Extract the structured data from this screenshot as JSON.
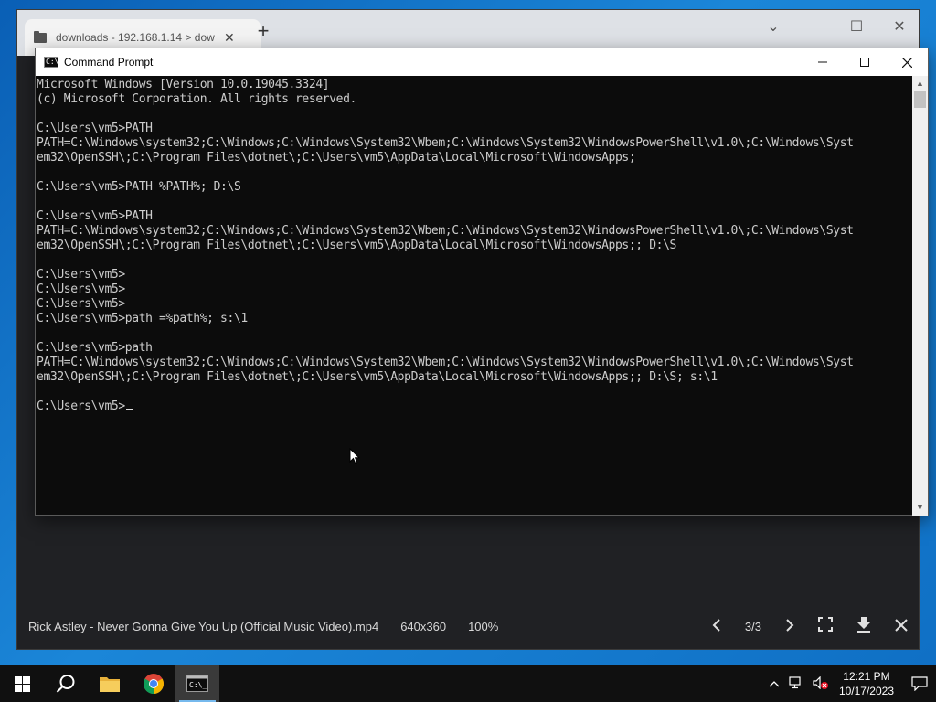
{
  "browser": {
    "tab_title": "downloads - 192.168.1.14 > dow",
    "tab_close": "✕",
    "new_tab": "+",
    "chevron": "⌄",
    "maximize": "☐",
    "close": "✕",
    "viewer": {
      "filename": "Rick Astley - Never Gonna Give You Up (Official Music Video).mp4",
      "dimensions": "640x360",
      "zoom": "100%",
      "pager": "3/3"
    }
  },
  "cmd": {
    "title": "Command Prompt",
    "icon_text": "C:\\",
    "lines": [
      "Microsoft Windows [Version 10.0.19045.3324]",
      "(c) Microsoft Corporation. All rights reserved.",
      "",
      "C:\\Users\\vm5>PATH",
      "PATH=C:\\Windows\\system32;C:\\Windows;C:\\Windows\\System32\\Wbem;C:\\Windows\\System32\\WindowsPowerShell\\v1.0\\;C:\\Windows\\Syst",
      "em32\\OpenSSH\\;C:\\Program Files\\dotnet\\;C:\\Users\\vm5\\AppData\\Local\\Microsoft\\WindowsApps;",
      "",
      "C:\\Users\\vm5>PATH %PATH%; D:\\S",
      "",
      "C:\\Users\\vm5>PATH",
      "PATH=C:\\Windows\\system32;C:\\Windows;C:\\Windows\\System32\\Wbem;C:\\Windows\\System32\\WindowsPowerShell\\v1.0\\;C:\\Windows\\Syst",
      "em32\\OpenSSH\\;C:\\Program Files\\dotnet\\;C:\\Users\\vm5\\AppData\\Local\\Microsoft\\WindowsApps;; D:\\S",
      "",
      "C:\\Users\\vm5>",
      "C:\\Users\\vm5>",
      "C:\\Users\\vm5>",
      "C:\\Users\\vm5>path =%path%; s:\\1",
      "",
      "C:\\Users\\vm5>path",
      "PATH=C:\\Windows\\system32;C:\\Windows;C:\\Windows\\System32\\Wbem;C:\\Windows\\System32\\WindowsPowerShell\\v1.0\\;C:\\Windows\\Syst",
      "em32\\OpenSSH\\;C:\\Program Files\\dotnet\\;C:\\Users\\vm5\\AppData\\Local\\Microsoft\\WindowsApps;; D:\\S; s:\\1",
      ""
    ],
    "prompt": "C:\\Users\\vm5>"
  },
  "taskbar": {
    "apps": [
      "start-icon",
      "search-icon",
      "file-explorer-icon",
      "chrome-icon",
      "command-prompt-icon"
    ],
    "time": "12:21 PM",
    "date": "10/17/2023"
  }
}
